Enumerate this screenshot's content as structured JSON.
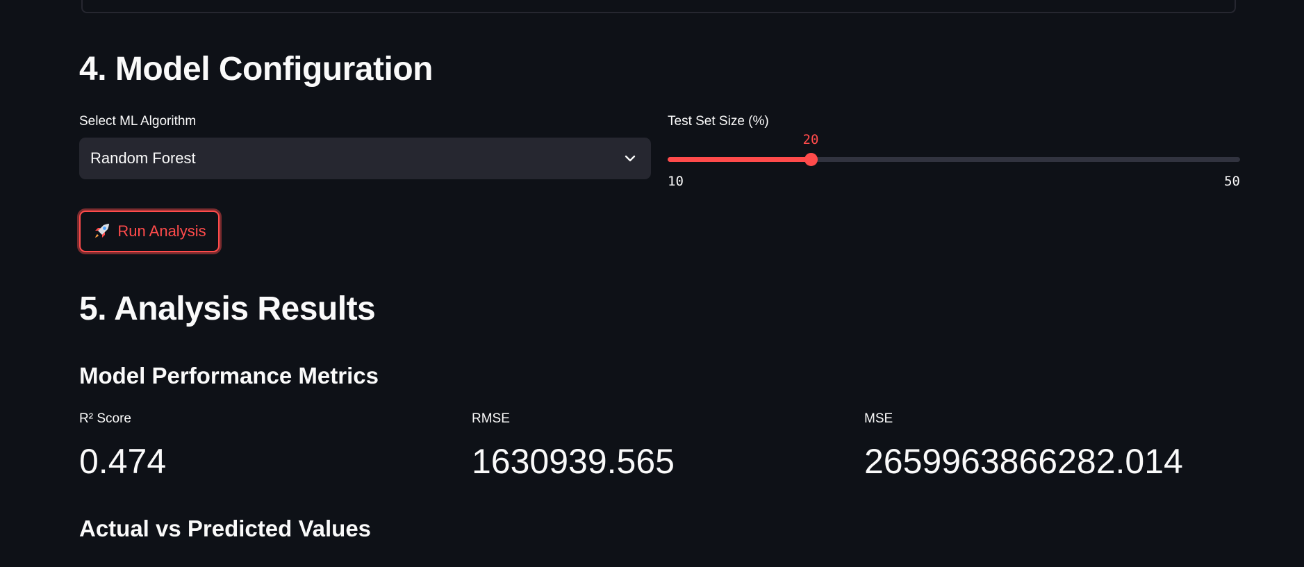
{
  "section_model_config": {
    "title": "4. Model Configuration",
    "algorithm_label": "Select ML Algorithm",
    "algorithm_value": "Random Forest",
    "test_size_label": "Test Set Size (%)",
    "test_size_value": "20",
    "test_size_min": "10",
    "test_size_max": "50",
    "test_size_fraction": 0.25,
    "run_button_label": "Run Analysis",
    "run_button_icon": "rocket-icon"
  },
  "section_results": {
    "title": "5. Analysis Results",
    "metrics_title": "Model Performance Metrics",
    "metrics": [
      {
        "label": "R² Score",
        "value": "0.474"
      },
      {
        "label": "RMSE",
        "value": "1630939.565"
      },
      {
        "label": "MSE",
        "value": "2659963866282.014"
      }
    ],
    "plot_title": "Actual vs Predicted Values"
  },
  "colors": {
    "background": "#0e1117",
    "accent": "#ff4b4b",
    "widget_bg": "#262730",
    "text": "#fafafa"
  }
}
